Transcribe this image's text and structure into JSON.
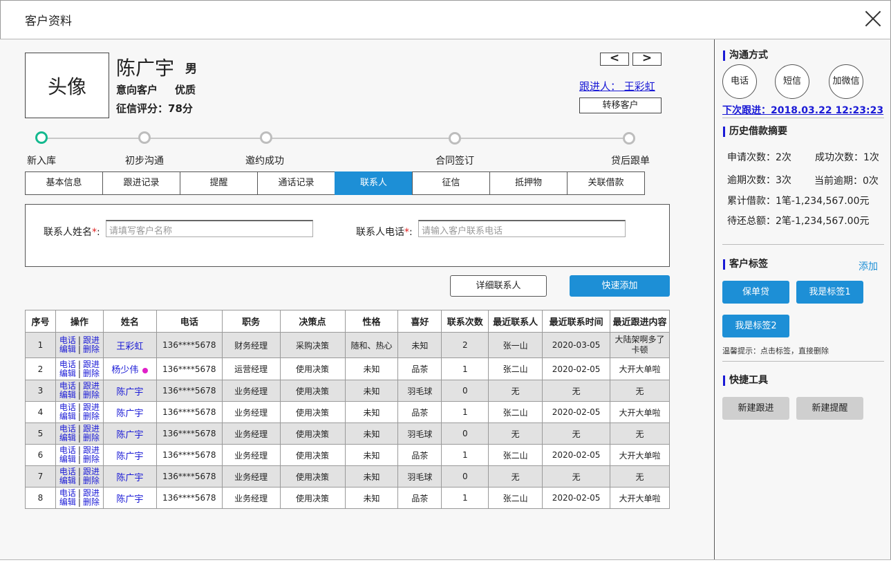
{
  "window": {
    "title": "客户资料"
  },
  "profile": {
    "avatar_label": "头像",
    "name": "陈广宇",
    "gender": "男",
    "intent": "意向客户",
    "quality": "优质",
    "credit": "征信评分：78分",
    "prev_label": "<",
    "next_label": ">",
    "follower": "跟进人： 王彩虹",
    "transfer_label": "转移客户"
  },
  "steps": [
    "新入库",
    "初步沟通",
    "邀约成功",
    "合同签订",
    "贷后跟单"
  ],
  "tabs": [
    "基本信息",
    "跟进记录",
    "提醒",
    "通话记录",
    "联系人",
    "征信",
    "抵押物",
    "关联借款"
  ],
  "active_tab": "联系人",
  "form": {
    "name_label": "联系人姓名",
    "name_placeholder": "请填写客户名称",
    "phone_label": "联系人电话",
    "phone_placeholder": "请输入客户联系电话",
    "required_mark": "*",
    "colon": ":"
  },
  "actions": {
    "detail": "详细联系人",
    "quick_add": "快速添加"
  },
  "table": {
    "headers": [
      "序号",
      "操作",
      "姓名",
      "电话",
      "职务",
      "决策点",
      "性格",
      "喜好",
      "联系次数",
      "最近联系人",
      "最近联系时间",
      "最近跟进内容"
    ],
    "op_labels": {
      "call": "电话",
      "follow": "跟进",
      "edit": "编辑",
      "delete": "删除",
      "sep": "|"
    },
    "rows": [
      {
        "no": "1",
        "name": "王彩虹",
        "phone": "136****5678",
        "title": "财务经理",
        "decision": "采购决策",
        "personality": "随和、热心",
        "hobby": "未知",
        "count": "2",
        "last_contact": "张一山",
        "last_time": "2020-03-05",
        "last_content": "大陆架啊多了卡顿",
        "dot": false
      },
      {
        "no": "2",
        "name": "杨少伟",
        "phone": "136****5678",
        "title": "运营经理",
        "decision": "使用决策",
        "personality": "未知",
        "hobby": "品茶",
        "count": "1",
        "last_contact": "张二山",
        "last_time": "2020-02-05",
        "last_content": "大开大单啦",
        "dot": true
      },
      {
        "no": "3",
        "name": "陈广宇",
        "phone": "136****5678",
        "title": "业务经理",
        "decision": "使用决策",
        "personality": "未知",
        "hobby": "羽毛球",
        "count": "0",
        "last_contact": "无",
        "last_time": "无",
        "last_content": "无",
        "dot": false
      },
      {
        "no": "4",
        "name": "陈广宇",
        "phone": "136****5678",
        "title": "业务经理",
        "decision": "使用决策",
        "personality": "未知",
        "hobby": "品茶",
        "count": "1",
        "last_contact": "张二山",
        "last_time": "2020-02-05",
        "last_content": "大开大单啦",
        "dot": false
      },
      {
        "no": "5",
        "name": "陈广宇",
        "phone": "136****5678",
        "title": "业务经理",
        "decision": "使用决策",
        "personality": "未知",
        "hobby": "羽毛球",
        "count": "0",
        "last_contact": "无",
        "last_time": "无",
        "last_content": "无",
        "dot": false
      },
      {
        "no": "6",
        "name": "陈广宇",
        "phone": "136****5678",
        "title": "业务经理",
        "decision": "使用决策",
        "personality": "未知",
        "hobby": "品茶",
        "count": "1",
        "last_contact": "张二山",
        "last_time": "2020-02-05",
        "last_content": "大开大单啦",
        "dot": false
      },
      {
        "no": "7",
        "name": "陈广宇",
        "phone": "136****5678",
        "title": "业务经理",
        "decision": "使用决策",
        "personality": "未知",
        "hobby": "羽毛球",
        "count": "0",
        "last_contact": "无",
        "last_time": "无",
        "last_content": "无",
        "dot": false
      },
      {
        "no": "8",
        "name": "陈广宇",
        "phone": "136****5678",
        "title": "业务经理",
        "decision": "使用决策",
        "personality": "未知",
        "hobby": "品茶",
        "count": "1",
        "last_contact": "张二山",
        "last_time": "2020-02-05",
        "last_content": "大开大单啦",
        "dot": false
      }
    ]
  },
  "sidebar": {
    "comm_title": "沟通方式",
    "comm_buttons": [
      "电话",
      "短信",
      "加微信"
    ],
    "next_follow": "下次跟进：2018.03.22 12:23:23",
    "history_title": "历史借款摘要",
    "history": {
      "apply": "申请次数：2次",
      "success": "成功次数：1次",
      "overdue": "逾期次数：3次",
      "current_overdue": "当前逾期：0次",
      "total": "累计借款：1笔-1,234,567.00元",
      "pending": "待还总额：2笔-1,234,567.00元"
    },
    "tags_title": "客户标签",
    "tags_add": "添加",
    "tags": [
      "保单贷",
      "我是标签1",
      "我是标签2"
    ],
    "hint": "温馨提示：点击标签，直接删除",
    "tools_title": "快捷工具",
    "tools": [
      "新建跟进",
      "新建提醒"
    ]
  },
  "colors": {
    "accent": "#1d8fd6",
    "link": "#1a1ad6",
    "step_active": "#14b98f",
    "required": "#e02020",
    "dot": "#e020c8"
  }
}
